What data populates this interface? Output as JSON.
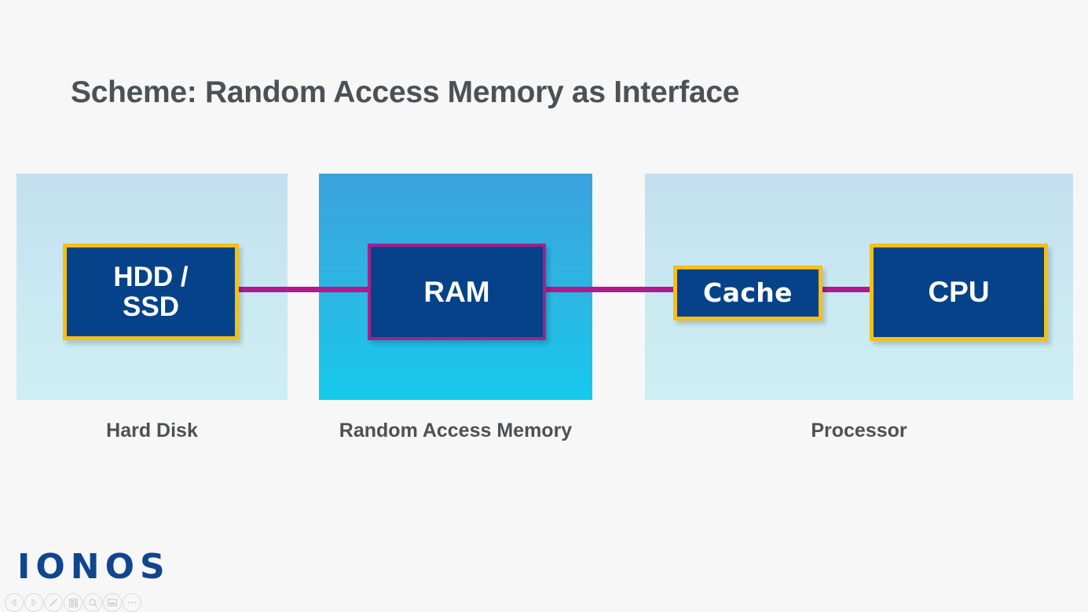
{
  "slide": {
    "title": "Scheme: Random Access Memory as Interface",
    "background_color": "#f7f7f7",
    "title_color": "#4a5257"
  },
  "diagram": {
    "connector_color": "#b01a8c",
    "box_fill_color": "#054289",
    "panels": [
      {
        "id": "hard-disk",
        "caption": "Hard Disk",
        "gradient_from": "#c3dff0",
        "gradient_to": "#cdeef4",
        "boxes": [
          {
            "id": "hdd-ssd",
            "label": "HDD /\nSSD",
            "line1": "HDD /",
            "line2": "SSD",
            "border_color": "#f5bf17",
            "border_style": "gold"
          }
        ]
      },
      {
        "id": "random-access-memory",
        "caption": "Random Access Memory",
        "gradient_from": "#3ba2dc",
        "gradient_to": "#15c9ec",
        "boxes": [
          {
            "id": "ram",
            "label": "RAM",
            "border_color": "#a4218c",
            "border_style": "magenta"
          }
        ]
      },
      {
        "id": "processor",
        "caption": "Processor",
        "gradient_from": "#c3dff0",
        "gradient_to": "#cdeef4",
        "boxes": [
          {
            "id": "cache",
            "label": "Cache",
            "border_color": "#f5bf17",
            "border_style": "gold"
          },
          {
            "id": "cpu",
            "label": "CPU",
            "border_color": "#f5bf17",
            "border_style": "gold"
          }
        ]
      }
    ],
    "connectors": [
      {
        "from": "hdd-ssd",
        "to": "ram"
      },
      {
        "from": "ram",
        "to": "cache"
      },
      {
        "from": "cache",
        "to": "cpu"
      }
    ]
  },
  "logo": {
    "text": "IONOS",
    "color": "#10458f"
  },
  "toolbar": {
    "buttons": [
      {
        "icon": "previous-icon",
        "label": "Previous"
      },
      {
        "icon": "next-icon",
        "label": "Next"
      },
      {
        "icon": "pen-icon",
        "label": "Draw"
      },
      {
        "icon": "layout-icon",
        "label": "Layout"
      },
      {
        "icon": "search-icon",
        "label": "Search"
      },
      {
        "icon": "presentation-icon",
        "label": "Presentation"
      },
      {
        "icon": "more-icon",
        "label": "More"
      }
    ]
  }
}
